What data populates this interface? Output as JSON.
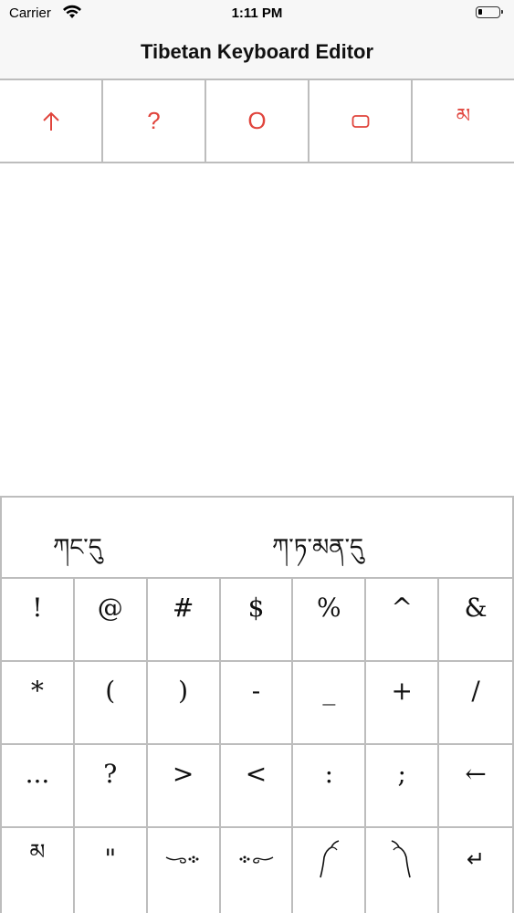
{
  "status_bar": {
    "carrier": "Carrier",
    "time": "1:11 PM"
  },
  "nav": {
    "title": "Tibetan Keyboard Editor"
  },
  "toolbar": {
    "accent_color": "#e0443c",
    "buttons": [
      {
        "icon": "arrow-up-icon",
        "label": ""
      },
      {
        "icon": "question-icon",
        "label": "?"
      },
      {
        "icon": "circle-o-icon",
        "label": "O"
      },
      {
        "icon": "rounded-rect-icon",
        "label": ""
      },
      {
        "icon": "tibetan-ma-icon",
        "label": "མ"
      }
    ]
  },
  "keyboard": {
    "suggestions": [
      "ཀང་དུ",
      "ཀ་ཏ་མན་དུ"
    ],
    "rows": [
      [
        "!",
        "@",
        "#",
        "$",
        "%",
        "^",
        "&"
      ],
      [
        "*",
        "(",
        ")",
        "-",
        "_",
        "+",
        "/"
      ],
      [
        "...",
        "?",
        ">",
        "<",
        ":",
        ";",
        "←"
      ],
      [
        "མ",
        "\"",
        "",
        "",
        "",
        "",
        "↵"
      ]
    ]
  }
}
